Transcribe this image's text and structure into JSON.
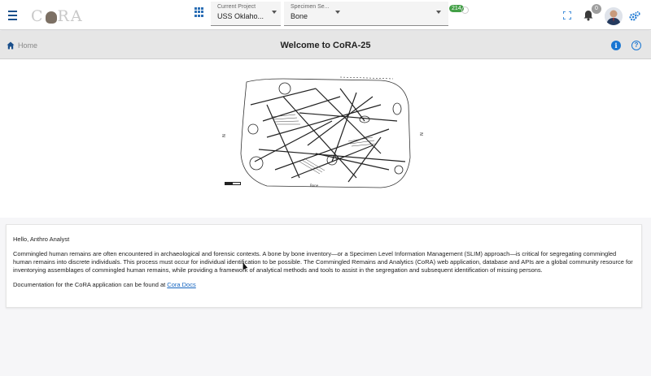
{
  "header": {
    "logo_text_left": "C",
    "logo_text_right": "RA",
    "project": {
      "label": "Current Project",
      "value": "USS Oklaho..."
    },
    "specimen": {
      "label": "Specimen Se...",
      "value": "Bone"
    },
    "green_badge": "214",
    "notification_count": "0"
  },
  "subheader": {
    "breadcrumb_home": "Home",
    "page_title": "Welcome to CoRA-25",
    "info_glyph": "i",
    "help_glyph": "?"
  },
  "hero": {
    "north_label_left": "N",
    "north_label_right": "N"
  },
  "card": {
    "greeting": "Hello, Anthro Analyst",
    "body": "Commingled human remains are often encountered in archaeological and forensic contexts. A bone by bone inventory—or a Specimen Level Information Management (SLIM) approach—is critical for segregating commingled human remains into discrete individuals. This process must occur for individual identification to be possible. The Commingled Remains and Analytics (CoRA) web application, database and APIs are a global community resource for inventorying assemblages of commingled human remains, while providing a framework of analytical methods and tools to assist in the segregation and subsequent identification of missing persons.",
    "docs_prefix": "Documentation for the CoRA application can be found at ",
    "docs_link": "Cora Docs"
  },
  "colors": {
    "accent": "#1976d2",
    "nav_blue": "#1a4f8b",
    "badge_green": "#43a047"
  },
  "icons": [
    "hamburger-icon",
    "grid-icon",
    "expand-icon",
    "bell-icon",
    "gears-icon",
    "home-icon",
    "info-icon",
    "help-icon"
  ]
}
